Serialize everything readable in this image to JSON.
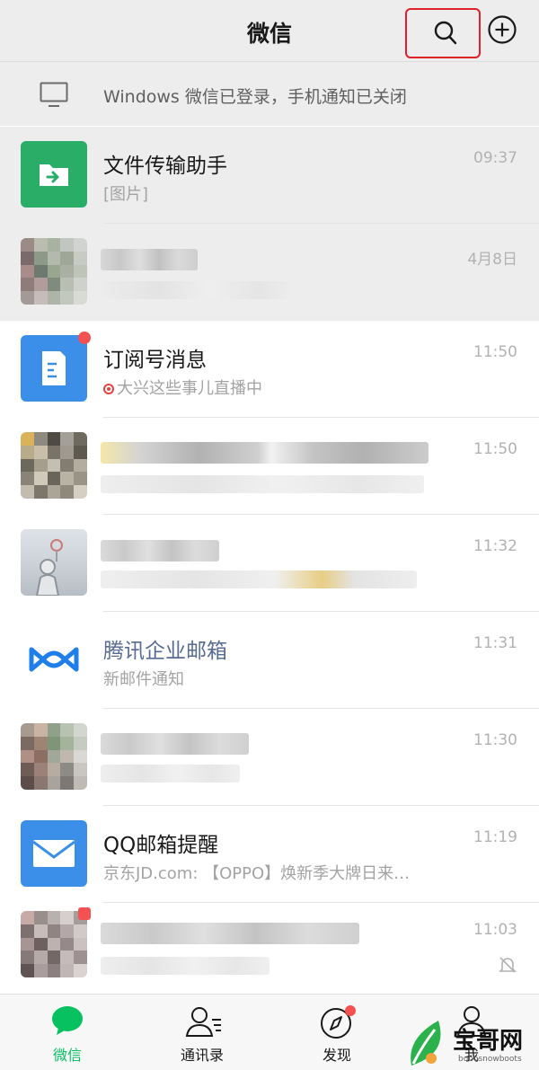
{
  "header": {
    "title": "微信"
  },
  "banner": {
    "text": "Windows 微信已登录，手机通知已关闭"
  },
  "chats": [
    {
      "name": "文件传输助手",
      "message": "[图片]",
      "time": "09:37"
    },
    {
      "name": "",
      "message": "",
      "time": "4月8日"
    },
    {
      "name": "订阅号消息",
      "message": "大兴这些事儿直播中",
      "time": "11:50"
    },
    {
      "name": "",
      "message": "",
      "time": "11:50"
    },
    {
      "name": "",
      "message": "",
      "time": "11:32"
    },
    {
      "name": "腾讯企业邮箱",
      "message": "新邮件通知",
      "time": "11:31"
    },
    {
      "name": "",
      "message": "",
      "time": "11:30"
    },
    {
      "name": "QQ邮箱提醒",
      "message": "京东JD.com: 【OPPO】焕新季大牌日来…",
      "time": "11:19"
    },
    {
      "name": "",
      "message": "",
      "time": "11:03"
    }
  ],
  "tabs": [
    {
      "label": "微信"
    },
    {
      "label": "通讯录"
    },
    {
      "label": "发现"
    },
    {
      "label": "我"
    }
  ],
  "watermark": {
    "text": "宝哥网",
    "subtext": "bobosnowboots"
  },
  "colors": {
    "accent": "#07c160",
    "badge": "#f55151",
    "highlight_box": "#e0202a"
  }
}
